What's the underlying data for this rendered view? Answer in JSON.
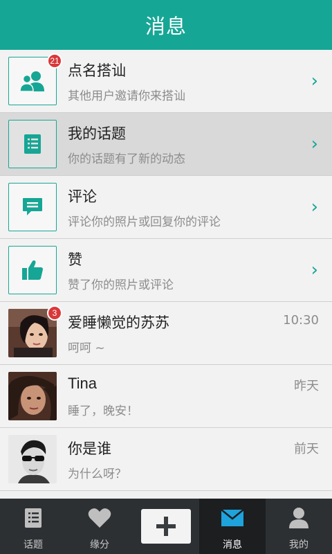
{
  "header": {
    "title": "消息"
  },
  "system_items": [
    {
      "title": "点名搭讪",
      "subtitle": "其他用户邀请你来搭讪",
      "badge": "21",
      "icon": "users-icon",
      "chevron": "›"
    },
    {
      "title": "我的话题",
      "subtitle": "你的话题有了新的动态",
      "badge": "",
      "icon": "list-icon",
      "chevron": "›"
    },
    {
      "title": "评论",
      "subtitle": "评论你的照片或回复你的评论",
      "badge": "",
      "icon": "comment-icon",
      "chevron": "›"
    },
    {
      "title": "赞",
      "subtitle": "赞了你的照片或评论",
      "badge": "",
      "icon": "thumbs-up-icon",
      "chevron": "›"
    }
  ],
  "conversations": [
    {
      "name": "爱睡懒觉的苏苏",
      "message": "呵呵 ~",
      "time": "10:30",
      "badge": "3"
    },
    {
      "name": "Tina",
      "message": "睡了，晚安！",
      "time": "昨天",
      "badge": ""
    },
    {
      "name": "你是谁",
      "message": "为什么呀？",
      "time": "前天",
      "badge": ""
    }
  ],
  "tabs": [
    {
      "label": "话题",
      "icon": "topic-list-icon"
    },
    {
      "label": "缘分",
      "icon": "heart-icon"
    },
    {
      "label": "",
      "icon": "plus-icon"
    },
    {
      "label": "消息",
      "icon": "mail-icon"
    },
    {
      "label": "我的",
      "icon": "person-icon"
    }
  ],
  "colors": {
    "accent": "#16a695",
    "badge": "#d9383a",
    "tabbar": "#2d3033",
    "tab_active": "#1c1e20",
    "mail_active": "#1ea3dc"
  }
}
